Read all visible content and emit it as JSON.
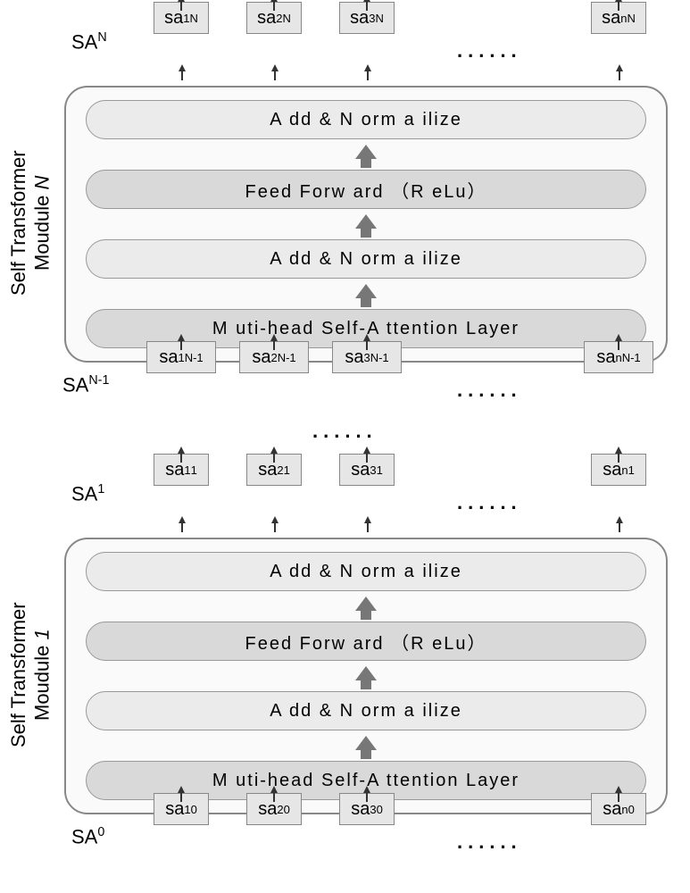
{
  "diagram": {
    "modules": [
      {
        "label_line1": "Self Transformer",
        "label_line2_prefix": "Moudule ",
        "label_line2_index": "N",
        "layers": {
          "top": "A dd & N orm a ilize",
          "ff": "Feed Forw ard （R eLu）",
          "mid": "A dd & N orm a ilize",
          "attn": "M uti-head Self-A ttention Layer"
        },
        "output_row": {
          "label_html": "SA<sup>N</sup>",
          "tokens_html": [
            "sa<sub>1</sub><sup>N</sup>",
            "sa<sub>2</sub><sup>N</sup>",
            "sa<sub>3</sub><sup>N</sup>",
            "sa<sub>n</sub><sup>N</sup>"
          ],
          "dots": "......"
        },
        "input_row": {
          "label_html": "SA<sup>N-1</sup>",
          "tokens_html": [
            "sa<sub>1</sub><sup>N-1</sup>",
            "sa<sub>2</sub><sup>N-1</sup>",
            "sa<sub>3</sub><sup>N-1</sup>",
            "sa<sub>n</sub><sup>N-1</sup>"
          ],
          "dots": "......"
        }
      },
      {
        "label_line1": "Self Transformer",
        "label_line2_prefix": "Moudule ",
        "label_line2_index": "1",
        "layers": {
          "top": "A dd & N orm a ilize",
          "ff": "Feed Forw ard （R eLu）",
          "mid": "A dd & N orm a ilize",
          "attn": "M uti-head Self-A ttention Layer"
        },
        "output_row": {
          "label_html": "SA<sup>1</sup>",
          "tokens_html": [
            "sa<sub>1</sub><sup>1</sup>",
            "sa<sub>2</sub><sup>1</sup>",
            "sa<sub>3</sub><sup>1</sup>",
            "sa<sub>n</sub><sup>1</sup>"
          ],
          "dots": "......"
        },
        "input_row": {
          "label_html": "SA<sup>0</sup>",
          "tokens_html": [
            "sa<sub>1</sub><sup>0</sup>",
            "sa<sub>2</sub><sup>0</sup>",
            "sa<sub>3</sub><sup>0</sup>",
            "sa<sub>n</sub><sup>0</sup>"
          ],
          "dots": "......"
        }
      }
    ],
    "between_dots": "......"
  }
}
